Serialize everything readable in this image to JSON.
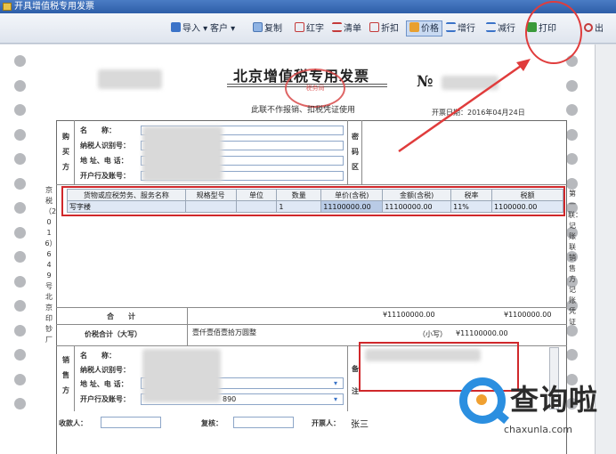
{
  "window": {
    "title": "开具增值税专用发票"
  },
  "toolbar": {
    "import": "导入",
    "customer": "客户",
    "copy": "复制",
    "red": "红字",
    "list": "清单",
    "discount": "折扣",
    "price": "价格",
    "add_row": "增行",
    "del_row": "减行",
    "print": "打印",
    "exit": "出",
    "colors": {
      "accent": "#2e5ea8",
      "print_icon": "#3a9a3a",
      "highlight": "#e03c3c"
    }
  },
  "invoice": {
    "title": "北京增值税专用发票",
    "seal_text": "税务局",
    "subtitle": "此联不作报销、扣税凭证使用",
    "no_label": "№",
    "date": "开票日期：2016年04月24日",
    "buyer": {
      "section": [
        "购",
        "买",
        "方"
      ],
      "name": "名　　称：",
      "tax_id": "纳税人识别号：",
      "address": "地 址、电 话：",
      "bank": "开户行及账号："
    },
    "password_area": [
      "密",
      "码",
      "区"
    ],
    "items": {
      "headers": [
        "货物或应税劳务、服务名称",
        "规格型号",
        "单位",
        "数量",
        "单价(含税)",
        "金额(含税)",
        "税率",
        "税额"
      ],
      "rows": [
        [
          "写字楼",
          "",
          "",
          "1",
          "11100000.00",
          "11100000.00",
          "11%",
          "1100000.00"
        ]
      ]
    },
    "totals": {
      "label": "合　　计",
      "amount": "¥11100000.00",
      "tax": "¥1100000.00",
      "in_words_label": "价税合计（大写）",
      "in_words": "壹仟壹佰壹拾万圆整",
      "small_label": "（小写）",
      "small_value": "¥11100000.00"
    },
    "seller": {
      "section": [
        "销",
        "售",
        "方"
      ],
      "name": "名　　称：",
      "tax_id": "纳税人识别号：",
      "address": "地 址、电 话：",
      "bank": "开户行及账号：",
      "bank_tail": "890"
    },
    "remarks": [
      "备",
      "注"
    ],
    "footer": {
      "payee": "收款人：",
      "reviewer": "复核：",
      "issuer": "开票人：",
      "issuer_name": "张三"
    },
    "left_margin_text": "京税（2016）649号北京印钞厂",
    "right_margin_text": "第一联：记账联 销售方记账凭证"
  },
  "watermark": {
    "cn": "查询啦",
    "en": "chaxunla.com"
  }
}
